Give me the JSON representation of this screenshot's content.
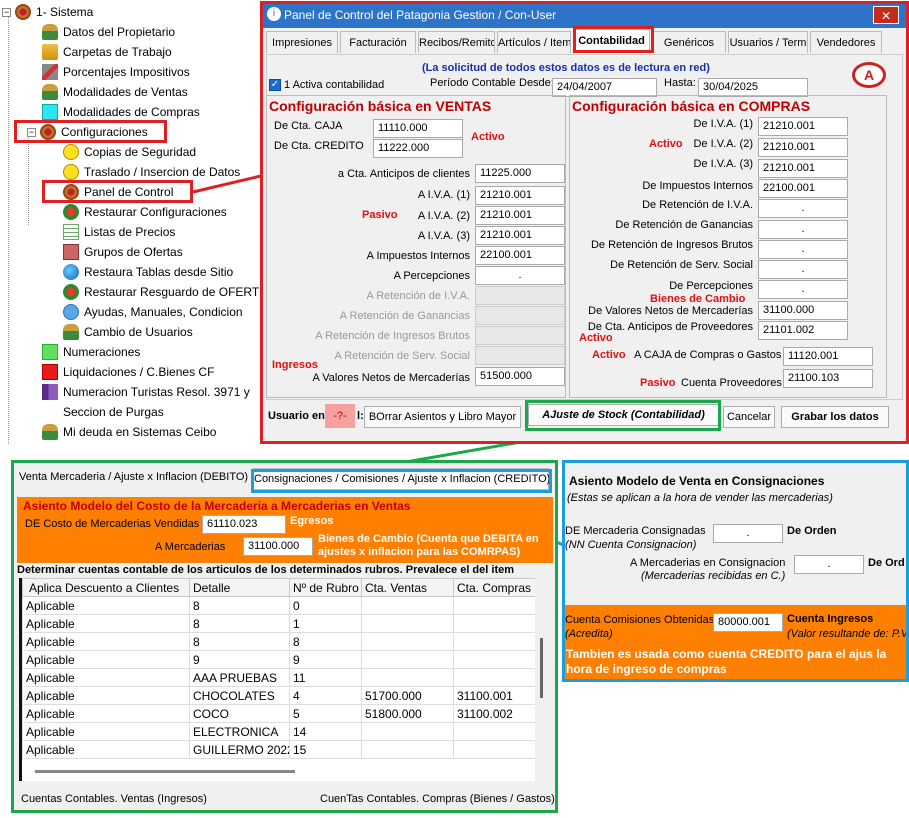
{
  "tree": {
    "root_label": "1- Sistema",
    "items": [
      {
        "label": "Datos del Propietario",
        "icon": "person-icon"
      },
      {
        "label": "Carpetas de Trabajo",
        "icon": "folder-icon"
      },
      {
        "label": "Porcentajes Impositivos",
        "icon": "percent-icon"
      },
      {
        "label": "Modalidades de Ventas",
        "icon": "person-icon"
      },
      {
        "label": "Modalidades de Compras",
        "icon": "cyan-square-icon"
      },
      {
        "label": "Configuraciones",
        "icon": "gear-icon"
      },
      {
        "label": "Copias de Seguridad",
        "icon": "smiley-icon"
      },
      {
        "label": "Traslado / Insercion de Datos",
        "icon": "smiley-icon"
      },
      {
        "label": "Panel de Control",
        "icon": "gear-icon"
      },
      {
        "label": "Restaurar Configuraciones",
        "icon": "flower-icon"
      },
      {
        "label": "Listas de Precios",
        "icon": "list-icon"
      },
      {
        "label": "Grupos de Ofertas",
        "icon": "offer-icon"
      },
      {
        "label": "Restaura Tablas desde Sitio",
        "icon": "globe-icon"
      },
      {
        "label": "Restaurar Resguardo de OFERT",
        "icon": "flower-icon"
      },
      {
        "label": "Ayudas, Manuales, Condicion",
        "icon": "help-icon"
      },
      {
        "label": "Cambio de Usuarios",
        "icon": "person-icon"
      },
      {
        "label": "Numeraciones",
        "icon": "green-square-icon"
      },
      {
        "label": "Liquidaciones / C.Bienes CF",
        "icon": "red-square-icon"
      },
      {
        "label": "Numeracion Turistas Resol. 3971 y",
        "icon": "book-icon"
      },
      {
        "label": "Seccion de Purgas",
        "icon": ""
      },
      {
        "label": "Mi deuda en Sistemas Ceibo",
        "icon": "person-icon"
      }
    ]
  },
  "dialog": {
    "title": "Panel de Control del Patagonia Gestion / Con-User",
    "close": "✕",
    "tabs": [
      "Impresiones",
      "Facturación",
      "Recibos/Remito",
      "Artículos / Item",
      "Contabilidad",
      "Genéricos",
      "Usuarios / Term",
      "Vendedores"
    ],
    "notice": "(La solicitud de todos estos datos es de lectura en red)",
    "activa_label": "1 Activa contabilidad",
    "periodo_label": "Período Contable",
    "desde_label": "Desde:",
    "desde_value": "24/04/2007",
    "hasta_label": "Hasta:",
    "hasta_value": "30/04/2025",
    "ventas": {
      "title": "Configuración básica en VENTAS",
      "caja_label": "De Cta. CAJA",
      "caja_value": "11110.000",
      "credito_label": "De Cta. CREDITO",
      "credito_value": "11222.000",
      "activo": "Activo",
      "anticipos_label": "a Cta. Anticipos de clientes",
      "anticipos_value": "11225.000",
      "pasivo": "Pasivo",
      "iva1_label": "A I.V.A. (1)",
      "iva1_value": "21210.001",
      "iva2_label": "A I.V.A. (2)",
      "iva2_value": "21210.001",
      "iva3_label": "A I.V.A. (3)",
      "iva3_value": "21210.001",
      "impint_label": "A Impuestos Internos",
      "impint_value": "22100.001",
      "percep_label": "A Percepciones",
      "percep_value": ".",
      "retiva_label": "A Retención de I.V.A.",
      "retgan_label": "A Retención de  Ganancias",
      "retib_label": "A Retención de Ingresos Brutos",
      "retss_label": "A Retención de Serv. Social",
      "ingresos": "Ingresos",
      "valnet_label": "A Valores Netos de Mercaderías",
      "valnet_value": "51500.000"
    },
    "compras": {
      "title": "Configuración básica en COMPRAS",
      "activo": "Activo",
      "iva1_label": "De I.V.A. (1)",
      "iva1_value": "21210.001",
      "iva2_label": "De I.V.A. (2)",
      "iva2_value": "21210.001",
      "iva3_label": "De I.V.A. (3)",
      "iva3_value": "21210.001",
      "impint_label": "De Impuestos Internos",
      "impint_value": "22100.001",
      "retiva_label": "De Retención de I.V.A.",
      "retiva_value": ".",
      "retgan_label": "De Retención de  Ganancias",
      "retgan_value": ".",
      "retib_label": "De Retención de Ingresos Brutos",
      "retib_value": ".",
      "retss_label": "De Retención de Serv. Social",
      "retss_value": ".",
      "percep_label": "De Percepciones",
      "percep_value": ".",
      "bienes": "Bienes de Cambio",
      "valnet_label": "De Valores Netos de Mercaderías",
      "valnet_value": "31100.000",
      "anticipos_label": "De Cta. Anticipos de Proveedores",
      "anticipos_value": "21101.002",
      "activo2": "Activo",
      "activo3": "Activo",
      "caja_label": "A CAJA de Compras o Gastos",
      "caja_value": "11120.001",
      "pasivo": "Pasivo",
      "prov_label": "Cuenta Proveedores",
      "prov_value": "21100.103"
    },
    "footer": {
      "usuario_label": "Usuario en",
      "usuario_suffix": "l:",
      "usuario_value": "-?-",
      "borrar": "BOrrar Asientos y Libro Mayor",
      "ajuste": "AJuste de Stock (Contabilidad)",
      "cancelar": "Cancelar",
      "grabar": "Grabar los datos"
    }
  },
  "bottom_left": {
    "tab1": "Venta Mercaderia / Ajuste x Inflacion (DEBITO)",
    "tab2": "Consignaciones / Comisiones / Ajuste x Inflacion (CREDITO)",
    "asiento_title": "Asiento Modelo del Costo de la Mercaderia a Mercaderias en Ventas",
    "de_costo_label": "DE Costo de Mercaderias Vendidas",
    "de_costo_value": "61110.023",
    "egresos": "Egresos",
    "a_merc_label": "A   Mercaderias",
    "a_merc_value": "31100.000",
    "bienes_note": "Bienes de Cambio (Cuenta que DEBITA en ajustes x inflacion para las COMRPAS)",
    "determinar": "Determinar cuentas contable de los articulos de los determinados rubros. Prevalece el del item",
    "columns": [
      "Aplica Descuento a Clientes",
      "Detalle",
      "Nº de Rubro",
      "Cta. Ventas",
      "Cta. Compras"
    ],
    "rows": [
      [
        "Aplicable",
        "8",
        "0",
        "",
        ""
      ],
      [
        "Aplicable",
        "8",
        "1",
        "",
        ""
      ],
      [
        "Aplicable",
        "8",
        "8",
        "",
        ""
      ],
      [
        "Aplicable",
        "9",
        "9",
        "",
        ""
      ],
      [
        "Aplicable",
        "AAA PRUEBAS",
        "11",
        "",
        ""
      ],
      [
        "Aplicable",
        "CHOCOLATES",
        "4",
        "51700.000",
        "31100.001"
      ],
      [
        "Aplicable",
        "COCO",
        "5",
        "51800.000",
        "31100.002"
      ],
      [
        "Aplicable",
        "ELECTRONICA",
        "14",
        "",
        ""
      ],
      [
        "Aplicable",
        "GUILLERMO 2022",
        "15",
        "",
        ""
      ]
    ],
    "footer_left": "Cuentas Contables. Ventas (Ingresos)",
    "footer_right": "CuenTas Contables. Compras (Bienes / Gastos)"
  },
  "bottom_right": {
    "title": "Asiento Modelo de  Venta en Consignaciones",
    "subtitle": "(Estas se aplican a la hora de vender las mercaderias)",
    "de_label": "DE Mercaderia Consignadas",
    "de_sub": "(NN Cuenta Consignacion)",
    "de_value": ".",
    "de_orden": "De Orden",
    "a_label": "A    Mercaderias en Consignacion",
    "a_sub": "(Mercaderias recibidas en C.)",
    "a_value": ".",
    "a_orden": "De Ord",
    "com_label": "Cuenta Comisiones Obtenidas",
    "com_sub": "(Acredita)",
    "com_value": "80000.001",
    "ingresos": "Cuenta Ingresos",
    "valor_note": "(Valor resultande de: P.V",
    "tambien": "Tambien es usada como cuenta CREDITO para el ajus la hora de ingreso de compras"
  },
  "colors": {
    "accent_red": "#e02020",
    "accent_green": "#1aa84a",
    "accent_blue": "#1a9ee0",
    "orange": "#ff8000",
    "title_blue": "#2d74c8"
  }
}
